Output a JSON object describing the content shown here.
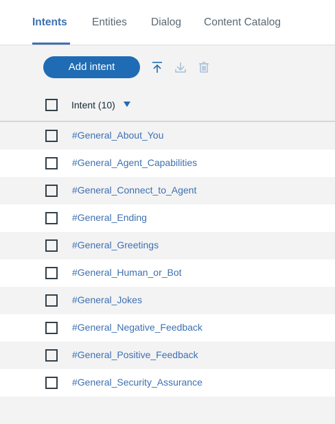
{
  "tabs": [
    {
      "label": "Intents",
      "active": true
    },
    {
      "label": "Entities",
      "active": false
    },
    {
      "label": "Dialog",
      "active": false
    },
    {
      "label": "Content Catalog",
      "active": false
    }
  ],
  "toolbar": {
    "add_label": "Add intent",
    "icons": [
      "upload-icon",
      "download-icon",
      "trash-icon"
    ]
  },
  "table": {
    "header_label": "Intent (10)",
    "sort": "descending"
  },
  "intents": [
    "#General_About_You",
    "#General_Agent_Capabilities",
    "#General_Connect_to_Agent",
    "#General_Ending",
    "#General_Greetings",
    "#General_Human_or_Bot",
    "#General_Jokes",
    "#General_Negative_Feedback",
    "#General_Positive_Feedback",
    "#General_Security_Assurance"
  ],
  "colors": {
    "accent": "#1f6cb5",
    "link": "#3d70b2",
    "row_alt": "#f3f3f3"
  }
}
